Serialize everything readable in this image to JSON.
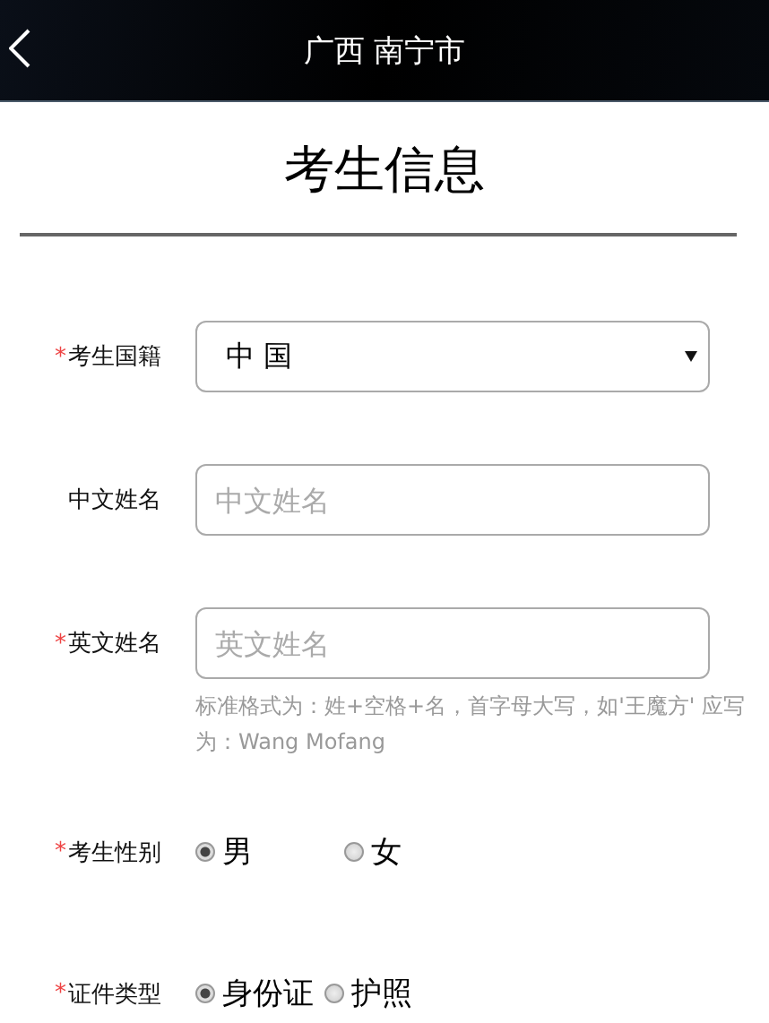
{
  "header": {
    "title": "广西 南宁市"
  },
  "page_title": "考生信息",
  "fields": [
    {
      "kind": "select",
      "label": "考生国籍",
      "required_mark": "*",
      "value": "中 国"
    },
    {
      "kind": "text",
      "label": "中文姓名",
      "placeholder": "中文姓名"
    },
    {
      "kind": "text",
      "label": "英文姓名",
      "required_mark": "*",
      "placeholder": "英文姓名",
      "hint": "标准格式为：姓+空格+名，首字母大写，如'王魔方' 应写为：Wang Mofang"
    },
    {
      "kind": "radio",
      "label": "考生性别",
      "required_mark": "*",
      "options": [
        {
          "label": "男",
          "selected": true
        },
        {
          "label": "女",
          "selected": false
        }
      ]
    },
    {
      "kind": "radio",
      "label": "证件类型",
      "required_mark": "*",
      "options": [
        {
          "label": "身份证",
          "selected": true
        },
        {
          "label": "护照",
          "selected": false
        }
      ]
    }
  ]
}
